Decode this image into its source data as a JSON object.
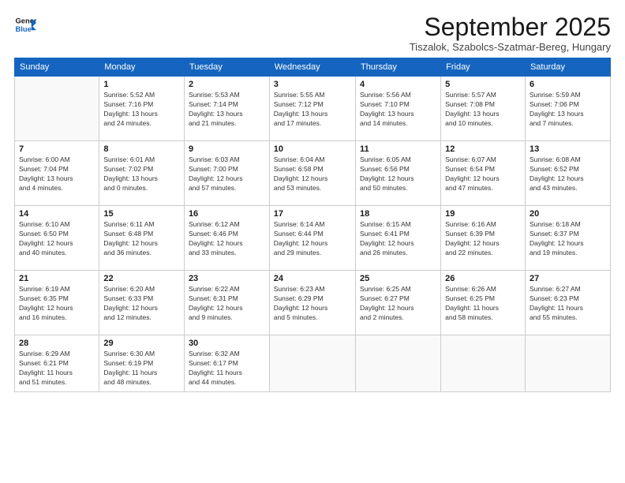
{
  "logo": {
    "line1": "General",
    "line2": "Blue"
  },
  "title": "September 2025",
  "location": "Tiszalok, Szabolcs-Szatmar-Bereg, Hungary",
  "days_of_week": [
    "Sunday",
    "Monday",
    "Tuesday",
    "Wednesday",
    "Thursday",
    "Friday",
    "Saturday"
  ],
  "weeks": [
    [
      {
        "day": "",
        "info": ""
      },
      {
        "day": "1",
        "info": "Sunrise: 5:52 AM\nSunset: 7:16 PM\nDaylight: 13 hours\nand 24 minutes."
      },
      {
        "day": "2",
        "info": "Sunrise: 5:53 AM\nSunset: 7:14 PM\nDaylight: 13 hours\nand 21 minutes."
      },
      {
        "day": "3",
        "info": "Sunrise: 5:55 AM\nSunset: 7:12 PM\nDaylight: 13 hours\nand 17 minutes."
      },
      {
        "day": "4",
        "info": "Sunrise: 5:56 AM\nSunset: 7:10 PM\nDaylight: 13 hours\nand 14 minutes."
      },
      {
        "day": "5",
        "info": "Sunrise: 5:57 AM\nSunset: 7:08 PM\nDaylight: 13 hours\nand 10 minutes."
      },
      {
        "day": "6",
        "info": "Sunrise: 5:59 AM\nSunset: 7:06 PM\nDaylight: 13 hours\nand 7 minutes."
      }
    ],
    [
      {
        "day": "7",
        "info": "Sunrise: 6:00 AM\nSunset: 7:04 PM\nDaylight: 13 hours\nand 4 minutes."
      },
      {
        "day": "8",
        "info": "Sunrise: 6:01 AM\nSunset: 7:02 PM\nDaylight: 13 hours\nand 0 minutes."
      },
      {
        "day": "9",
        "info": "Sunrise: 6:03 AM\nSunset: 7:00 PM\nDaylight: 12 hours\nand 57 minutes."
      },
      {
        "day": "10",
        "info": "Sunrise: 6:04 AM\nSunset: 6:58 PM\nDaylight: 12 hours\nand 53 minutes."
      },
      {
        "day": "11",
        "info": "Sunrise: 6:05 AM\nSunset: 6:56 PM\nDaylight: 12 hours\nand 50 minutes."
      },
      {
        "day": "12",
        "info": "Sunrise: 6:07 AM\nSunset: 6:54 PM\nDaylight: 12 hours\nand 47 minutes."
      },
      {
        "day": "13",
        "info": "Sunrise: 6:08 AM\nSunset: 6:52 PM\nDaylight: 12 hours\nand 43 minutes."
      }
    ],
    [
      {
        "day": "14",
        "info": "Sunrise: 6:10 AM\nSunset: 6:50 PM\nDaylight: 12 hours\nand 40 minutes."
      },
      {
        "day": "15",
        "info": "Sunrise: 6:11 AM\nSunset: 6:48 PM\nDaylight: 12 hours\nand 36 minutes."
      },
      {
        "day": "16",
        "info": "Sunrise: 6:12 AM\nSunset: 6:46 PM\nDaylight: 12 hours\nand 33 minutes."
      },
      {
        "day": "17",
        "info": "Sunrise: 6:14 AM\nSunset: 6:44 PM\nDaylight: 12 hours\nand 29 minutes."
      },
      {
        "day": "18",
        "info": "Sunrise: 6:15 AM\nSunset: 6:41 PM\nDaylight: 12 hours\nand 26 minutes."
      },
      {
        "day": "19",
        "info": "Sunrise: 6:16 AM\nSunset: 6:39 PM\nDaylight: 12 hours\nand 22 minutes."
      },
      {
        "day": "20",
        "info": "Sunrise: 6:18 AM\nSunset: 6:37 PM\nDaylight: 12 hours\nand 19 minutes."
      }
    ],
    [
      {
        "day": "21",
        "info": "Sunrise: 6:19 AM\nSunset: 6:35 PM\nDaylight: 12 hours\nand 16 minutes."
      },
      {
        "day": "22",
        "info": "Sunrise: 6:20 AM\nSunset: 6:33 PM\nDaylight: 12 hours\nand 12 minutes."
      },
      {
        "day": "23",
        "info": "Sunrise: 6:22 AM\nSunset: 6:31 PM\nDaylight: 12 hours\nand 9 minutes."
      },
      {
        "day": "24",
        "info": "Sunrise: 6:23 AM\nSunset: 6:29 PM\nDaylight: 12 hours\nand 5 minutes."
      },
      {
        "day": "25",
        "info": "Sunrise: 6:25 AM\nSunset: 6:27 PM\nDaylight: 12 hours\nand 2 minutes."
      },
      {
        "day": "26",
        "info": "Sunrise: 6:26 AM\nSunset: 6:25 PM\nDaylight: 11 hours\nand 58 minutes."
      },
      {
        "day": "27",
        "info": "Sunrise: 6:27 AM\nSunset: 6:23 PM\nDaylight: 11 hours\nand 55 minutes."
      }
    ],
    [
      {
        "day": "28",
        "info": "Sunrise: 6:29 AM\nSunset: 6:21 PM\nDaylight: 11 hours\nand 51 minutes."
      },
      {
        "day": "29",
        "info": "Sunrise: 6:30 AM\nSunset: 6:19 PM\nDaylight: 11 hours\nand 48 minutes."
      },
      {
        "day": "30",
        "info": "Sunrise: 6:32 AM\nSunset: 6:17 PM\nDaylight: 11 hours\nand 44 minutes."
      },
      {
        "day": "",
        "info": ""
      },
      {
        "day": "",
        "info": ""
      },
      {
        "day": "",
        "info": ""
      },
      {
        "day": "",
        "info": ""
      }
    ]
  ]
}
